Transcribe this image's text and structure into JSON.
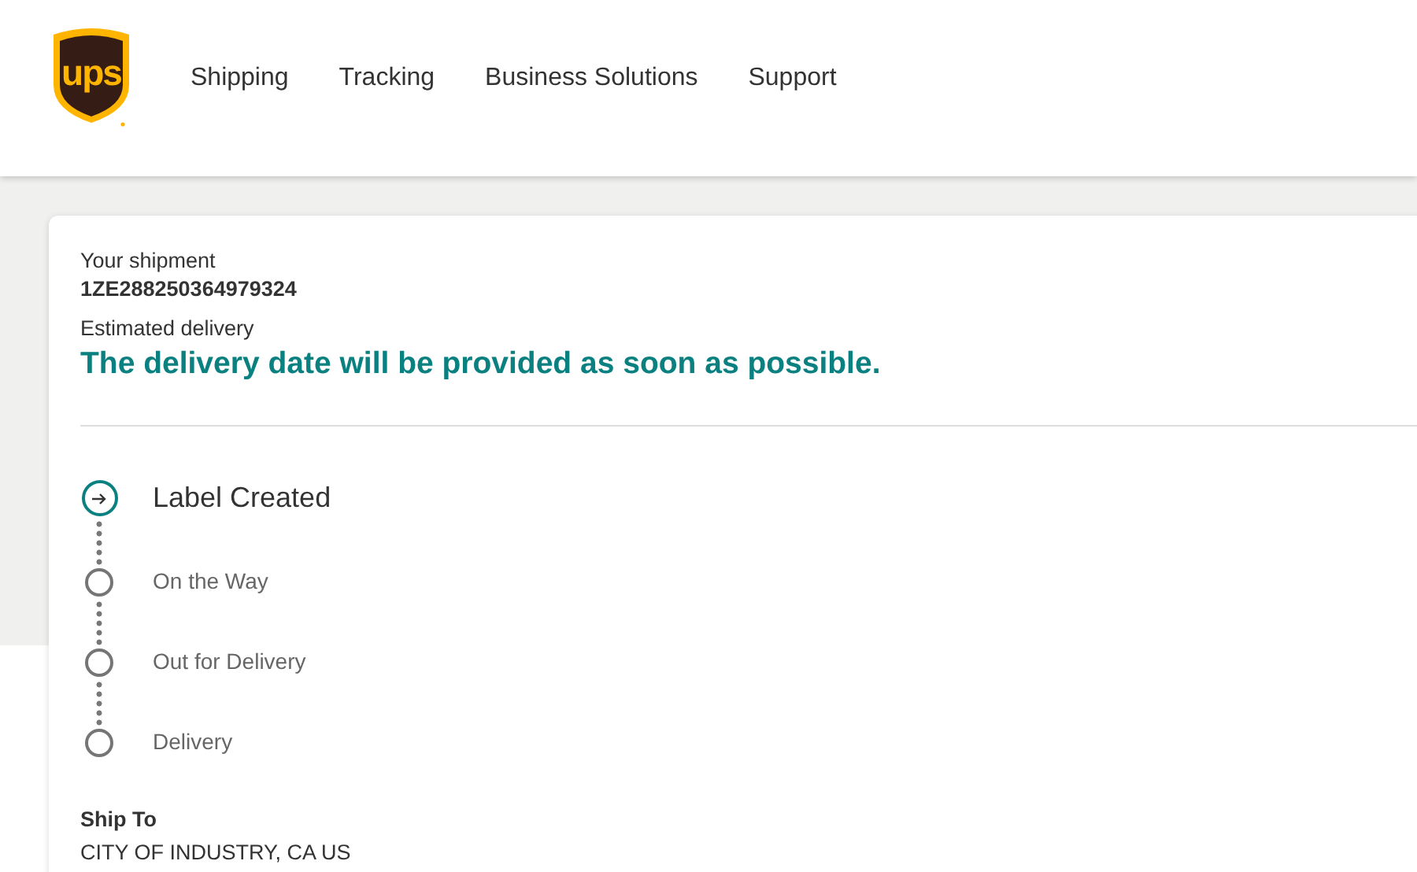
{
  "header": {
    "logo_text": "ups",
    "nav": [
      "Shipping",
      "Tracking",
      "Business Solutions",
      "Support"
    ]
  },
  "shipment": {
    "label": "Your shipment",
    "tracking_number": "1ZE288250364979324",
    "estimate_label": "Estimated delivery",
    "estimate": "The delivery date will be provided as soon as possible."
  },
  "steps": [
    {
      "label": "Label Created",
      "current": true
    },
    {
      "label": "On the Way",
      "current": false
    },
    {
      "label": "Out for Delivery",
      "current": false
    },
    {
      "label": "Delivery",
      "current": false
    }
  ],
  "ship_to": {
    "label": "Ship To",
    "address": "CITY OF INDUSTRY, CA US"
  }
}
